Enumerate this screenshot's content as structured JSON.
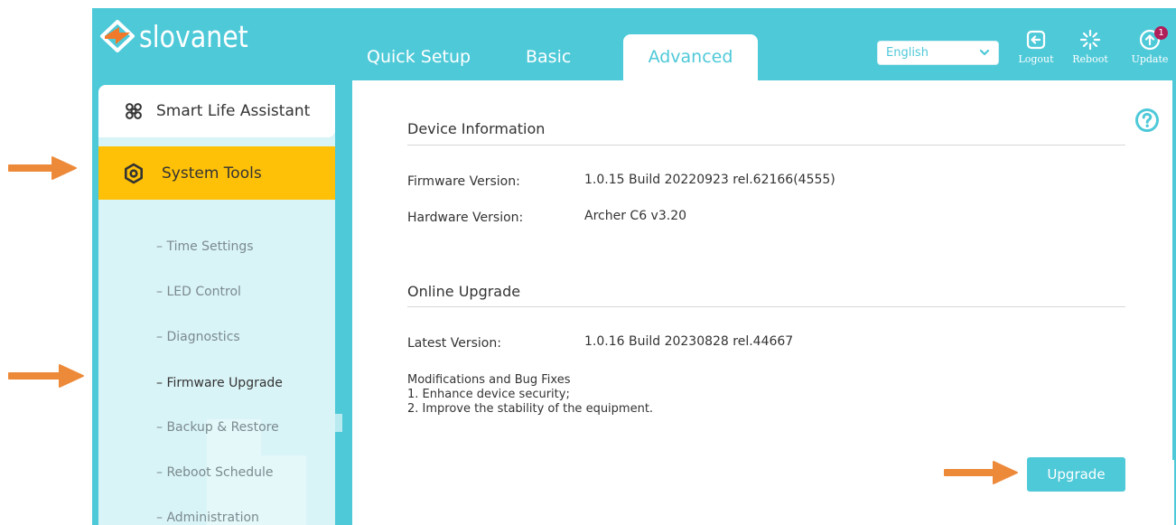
{
  "brand": {
    "name": "slovanet"
  },
  "colors": {
    "accent": "#4ec9d8",
    "active": "#ffc107",
    "badge": "#b01f5a",
    "arrow": "#ed8a3a"
  },
  "header": {
    "tabs": [
      {
        "label": "Quick Setup",
        "active": false
      },
      {
        "label": "Basic",
        "active": false
      },
      {
        "label": "Advanced",
        "active": true
      }
    ],
    "language": {
      "selected": "English"
    },
    "actions": [
      {
        "label": "Logout",
        "icon": "logout-icon"
      },
      {
        "label": "Reboot",
        "icon": "reboot-icon"
      },
      {
        "label": "Update",
        "icon": "update-icon",
        "badge": "1"
      }
    ]
  },
  "sidebar": {
    "top_item": {
      "label": "Smart Life Assistant",
      "icon": "command-icon"
    },
    "active_item": {
      "label": "System Tools",
      "icon": "gear-icon"
    },
    "sub_items": [
      {
        "label": "– Time Settings",
        "current": false
      },
      {
        "label": "– LED Control",
        "current": false
      },
      {
        "label": "– Diagnostics",
        "current": false
      },
      {
        "label": "– Firmware Upgrade",
        "current": true
      },
      {
        "label": "– Backup & Restore",
        "current": false
      },
      {
        "label": "– Reboot Schedule",
        "current": false
      },
      {
        "label": "– Administration",
        "current": false
      }
    ]
  },
  "main": {
    "device_info": {
      "title": "Device Information",
      "firmware_label": "Firmware Version:",
      "firmware_value": "1.0.15 Build 20220923 rel.62166(4555)",
      "hardware_label": "Hardware Version:",
      "hardware_value": "Archer C6 v3.20"
    },
    "online_upgrade": {
      "title": "Online Upgrade",
      "latest_label": "Latest Version:",
      "latest_value": "1.0.16 Build 20230828 rel.44667",
      "notes": [
        "Modifications and Bug Fixes",
        "1. Enhance device security;",
        "2. Improve the stability of the equipment."
      ],
      "button_label": "Upgrade"
    }
  }
}
